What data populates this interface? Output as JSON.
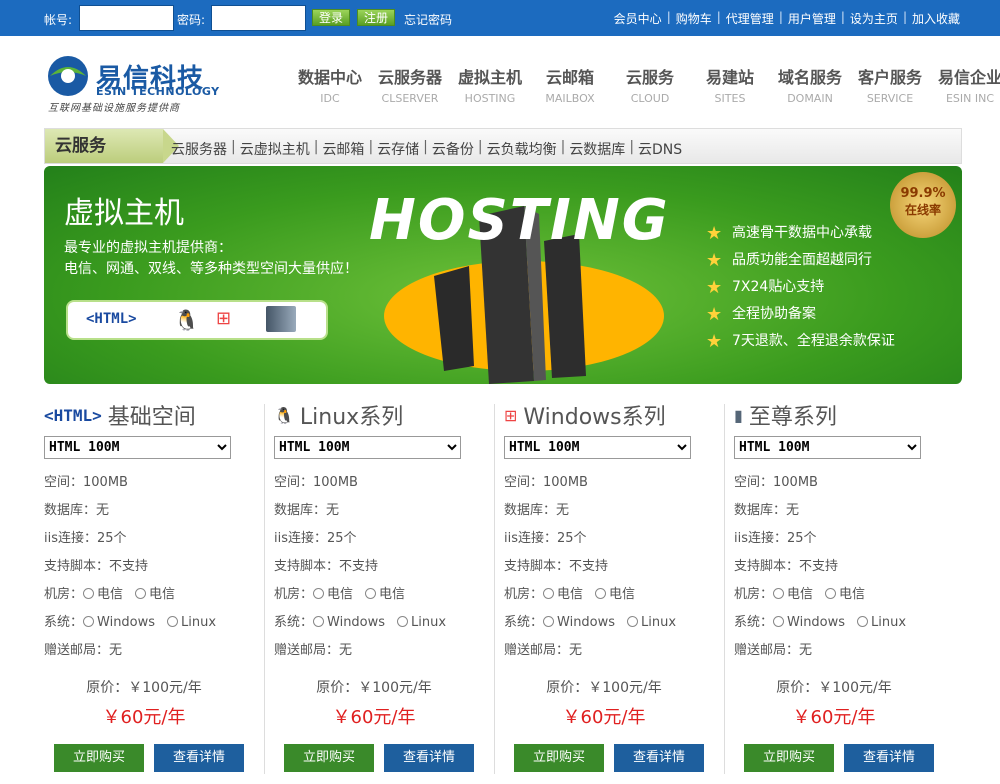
{
  "topbar": {
    "account_label": "帐号:",
    "password_label": "密码:",
    "login_button": "登录",
    "register_button": "注册",
    "forgot_link": "忘记密码",
    "links": [
      "会员中心",
      "购物车",
      "代理管理",
      "用户管理",
      "设为主页",
      "加入收藏"
    ]
  },
  "logo": {
    "name": "易信科技",
    "english": "ESIN TECHNOLOGY",
    "slogan": "互联网基础设施服务提供商"
  },
  "nav": [
    {
      "cn": "数据中心",
      "en": "IDC"
    },
    {
      "cn": "云服务器",
      "en": "CLSERVER"
    },
    {
      "cn": "虚拟主机",
      "en": "HOSTING"
    },
    {
      "cn": "云邮箱",
      "en": "MAILBOX"
    },
    {
      "cn": "云服务",
      "en": "CLOUD"
    },
    {
      "cn": "易建站",
      "en": "SITES"
    },
    {
      "cn": "域名服务",
      "en": "DOMAIN"
    },
    {
      "cn": "客户服务",
      "en": "SERVICE"
    },
    {
      "cn": "易信企业",
      "en": "ESIN INC"
    }
  ],
  "subnav": {
    "title": "云服务",
    "links": [
      "云服务器",
      "云虚拟主机",
      "云邮箱",
      "云存储",
      "云备份",
      "云负载均衡",
      "云数据库",
      "云DNS"
    ]
  },
  "banner": {
    "title": "虚拟主机",
    "desc_line1": "最专业的虚拟主机提供商：",
    "desc_line2": "电信、网通、双线、等多种类型空间大量供应！",
    "html_tag": "<HTML>",
    "hosting": "HOSTING",
    "badge_percent": "99.9%",
    "badge_text": "在线率",
    "features": [
      "高速骨干数据中心承载",
      "品质功能全面超越同行",
      "7X24贴心支持",
      "全程协助备案",
      "7天退款、全程退余款保证"
    ]
  },
  "products": [
    {
      "icon": "<HTML>",
      "name": "基础空间",
      "select": "HTML 100M",
      "space": "空间：100MB",
      "db": "数据库：无",
      "iis": "iis连接：25个",
      "script": "支持脚本：不支持",
      "room_label": "机房：",
      "room_opts": [
        "电信",
        "电信"
      ],
      "sys_label": "系统：",
      "sys_opts": [
        "Windows",
        "Linux"
      ],
      "mail": "赠送邮局：无",
      "orig": "原价：￥100元/年",
      "price": "￥60元/年",
      "buy": "立即购买",
      "detail": "查看详情"
    },
    {
      "icon": "🐧",
      "name": "Linux系列",
      "select": "HTML 100M",
      "space": "空间：100MB",
      "db": "数据库：无",
      "iis": "iis连接：25个",
      "script": "支持脚本：不支持",
      "room_label": "机房：",
      "room_opts": [
        "电信",
        "电信"
      ],
      "sys_label": "系统：",
      "sys_opts": [
        "Windows",
        "Linux"
      ],
      "mail": "赠送邮局：无",
      "orig": "原价：￥100元/年",
      "price": "￥60元/年",
      "buy": "立即购买",
      "detail": "查看详情"
    },
    {
      "icon": "⊞",
      "name": "Windows系列",
      "select": "HTML 100M",
      "space": "空间：100MB",
      "db": "数据库：无",
      "iis": "iis连接：25个",
      "script": "支持脚本：不支持",
      "room_label": "机房：",
      "room_opts": [
        "电信",
        "电信"
      ],
      "sys_label": "系统：",
      "sys_opts": [
        "Windows",
        "Linux"
      ],
      "mail": "赠送邮局：无",
      "orig": "原价：￥100元/年",
      "price": "￥60元/年",
      "buy": "立即购买",
      "detail": "查看详情"
    },
    {
      "icon": "▮",
      "name": "至尊系列",
      "select": "HTML 100M",
      "space": "空间：100MB",
      "db": "数据库：无",
      "iis": "iis连接：25个",
      "script": "支持脚本：不支持",
      "room_label": "机房：",
      "room_opts": [
        "电信",
        "电信"
      ],
      "sys_label": "系统：",
      "sys_opts": [
        "Windows",
        "Linux"
      ],
      "mail": "赠送邮局：无",
      "orig": "原价：￥100元/年",
      "price": "￥60元/年",
      "buy": "立即购买",
      "detail": "查看详情"
    }
  ]
}
